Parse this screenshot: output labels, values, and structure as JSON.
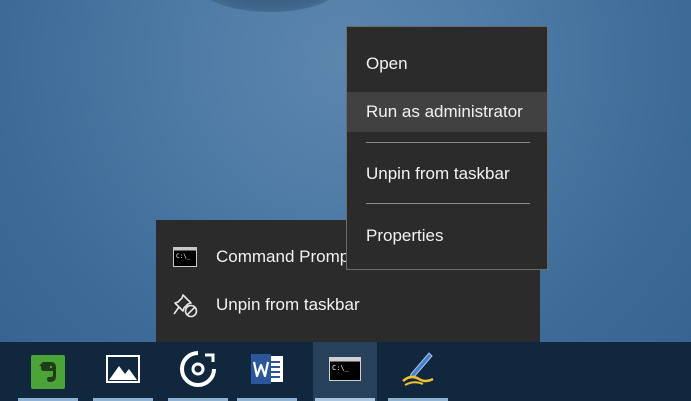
{
  "context_menu": {
    "items": [
      {
        "label": "Open"
      },
      {
        "label": "Run as administrator"
      },
      {
        "label": "Unpin from taskbar"
      },
      {
        "label": "Properties"
      }
    ]
  },
  "jump_list": {
    "items": [
      {
        "label": "Command Prompt",
        "icon": "command-prompt-icon"
      },
      {
        "label": "Unpin from taskbar",
        "icon": "unpin-icon"
      }
    ]
  },
  "taskbar": {
    "apps": [
      {
        "icon": "evernote-icon"
      },
      {
        "icon": "photos-icon"
      },
      {
        "icon": "groove-music-icon"
      },
      {
        "icon": "word-icon"
      },
      {
        "icon": "command-prompt-icon",
        "active": true
      },
      {
        "icon": "pen-tool-icon"
      }
    ]
  },
  "colors": {
    "menu_bg": "#2b2b2b",
    "menu_hover": "#414141",
    "taskbar_bg": "#10273d",
    "evernote_green": "#4aa437",
    "word_blue": "#2b579a"
  }
}
